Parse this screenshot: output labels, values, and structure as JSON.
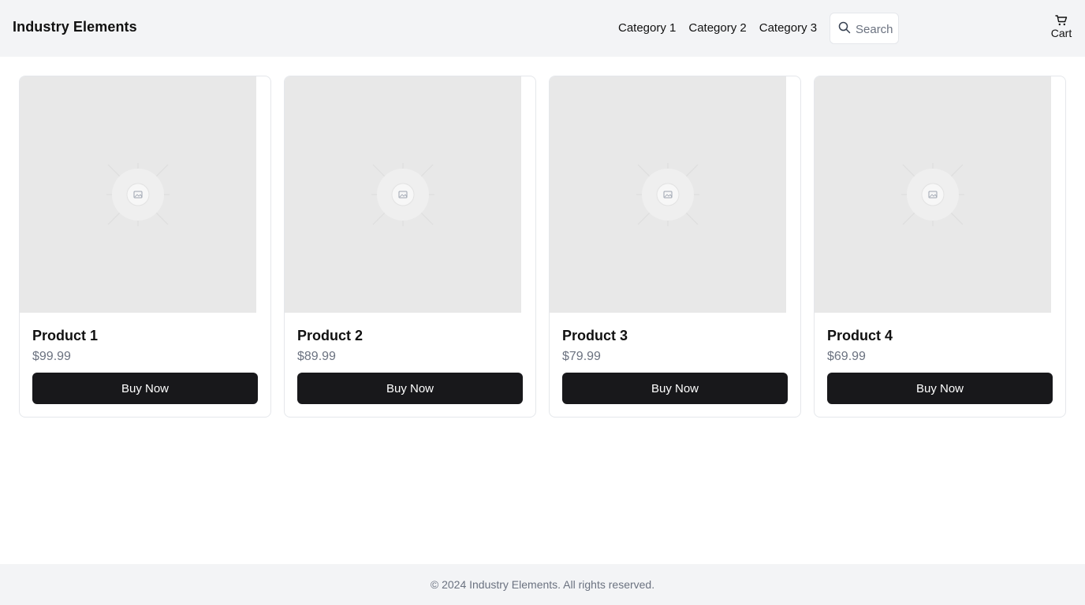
{
  "header": {
    "brand": "Industry Elements",
    "nav": [
      "Category 1",
      "Category 2",
      "Category 3"
    ],
    "search_placeholder": "Search",
    "cart_label": "Cart"
  },
  "products": [
    {
      "name": "Product 1",
      "price": "$99.99",
      "button": "Buy Now"
    },
    {
      "name": "Product 2",
      "price": "$89.99",
      "button": "Buy Now"
    },
    {
      "name": "Product 3",
      "price": "$79.99",
      "button": "Buy Now"
    },
    {
      "name": "Product 4",
      "price": "$69.99",
      "button": "Buy Now"
    }
  ],
  "footer": {
    "copyright": "© 2024 Industry Elements. All rights reserved."
  },
  "colors": {
    "header_bg": "#f3f4f6",
    "button_bg": "#18181b",
    "price_text": "#6b7280",
    "placeholder_bg": "#e8e8e8"
  }
}
